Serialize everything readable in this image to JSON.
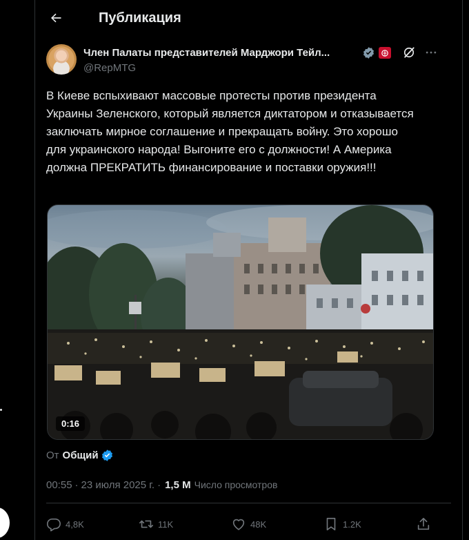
{
  "header": {
    "title": "Публикация"
  },
  "author": {
    "name": "Член Палаты представителей Марджори Тейл...",
    "handle": "@RepMTG"
  },
  "post": {
    "text": "В Киеве вспыхивают массовые протесты против президента Украины Зеленского, который является диктатором и отказывается заключать мирное соглашение и прекращать войну. Это хорошо для украинского народа! Выгоните его с должности! А Америка должна ПРЕКРАТИТЬ финансирование и поставки оружия!!!",
    "video_duration": "0:16"
  },
  "source": {
    "prefix": "От",
    "name": "Общий"
  },
  "meta": {
    "time": "00:55",
    "separator": "·",
    "date": "23 июля 2025 г.",
    "views": "1,5 М",
    "views_label": "Число просмотров"
  },
  "actions": {
    "replies": "4,8K",
    "reposts": "11K",
    "likes": "48K",
    "bookmarks": "1.2K"
  },
  "colors": {
    "background": "#000000",
    "text": "#e7e9ea",
    "muted": "#71767b",
    "verified": "#1d9bf0",
    "border": "#2f3336"
  },
  "icons": {
    "back": "arrow-left-icon",
    "verified": "verified-badge-icon",
    "gov": "gov-flag-icon",
    "grok": "grok-icon",
    "more": "more-horizontal-icon",
    "reply": "reply-icon",
    "repost": "repost-icon",
    "like": "heart-icon",
    "bookmark": "bookmark-icon",
    "share": "share-icon"
  }
}
